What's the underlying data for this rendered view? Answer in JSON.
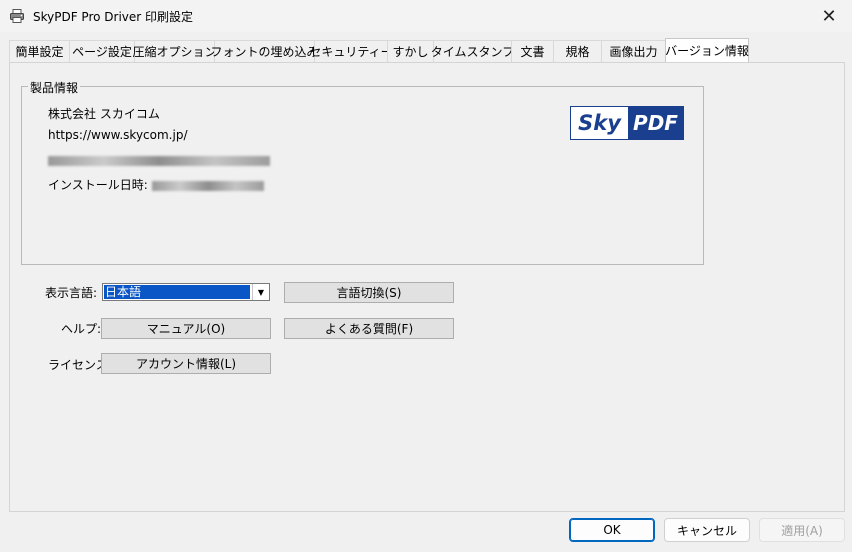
{
  "window": {
    "title": "SkyPDF Pro Driver 印刷設定",
    "close_symbol": "✕"
  },
  "tabs": [
    {
      "label": "簡単設定"
    },
    {
      "label": "ページ設定"
    },
    {
      "label": "圧縮オプション"
    },
    {
      "label": "フォントの埋め込み"
    },
    {
      "label": "セキュリティー"
    },
    {
      "label": "すかし"
    },
    {
      "label": "タイムスタンプ"
    },
    {
      "label": "文書"
    },
    {
      "label": "規格"
    },
    {
      "label": "画像出力"
    },
    {
      "label": "バージョン情報",
      "active": true
    }
  ],
  "product_info": {
    "legend": "製品情報",
    "company": "株式会社 スカイコム",
    "url": "https://www.skycom.jp/",
    "install_label": "インストール日時:",
    "logo": {
      "left": "Sky",
      "right": "PDF"
    }
  },
  "language": {
    "label": "表示言語:",
    "selected": "日本語",
    "switch_button": "言語切換(S)"
  },
  "help": {
    "label": "ヘルプ:",
    "manual_button": "マニュアル(O)",
    "faq_button": "よくある質問(F)"
  },
  "license": {
    "label": "ライセンス:",
    "account_button": "アカウント情報(L)"
  },
  "footer": {
    "ok": "OK",
    "cancel": "キャンセル",
    "apply": "適用(A)"
  },
  "colors": {
    "logo_blue": "#1a3f8f",
    "select_highlight": "#0a56c7",
    "primary_border": "#0067c0"
  }
}
